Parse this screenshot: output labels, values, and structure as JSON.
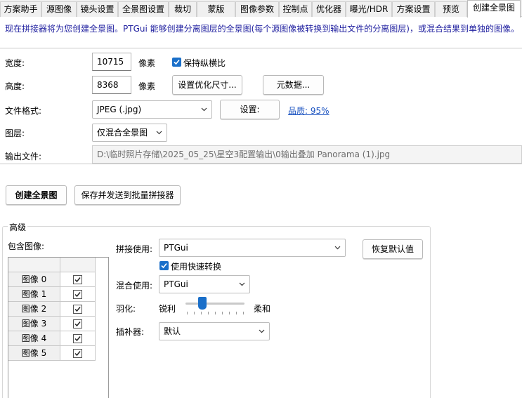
{
  "tabs": [
    {
      "label": "方案助手"
    },
    {
      "label": "源图像"
    },
    {
      "label": "镜头设置"
    },
    {
      "label": "全景图设置"
    },
    {
      "label": "裁切"
    },
    {
      "label": "蒙版"
    },
    {
      "label": "图像参数"
    },
    {
      "label": "控制点"
    },
    {
      "label": "优化器"
    },
    {
      "label": "曝光/HDR"
    },
    {
      "label": "方案设置"
    },
    {
      "label": "预览"
    },
    {
      "label": "创建全景图",
      "active": true
    }
  ],
  "info_text": "现在拼接器将为您创建全景图。PTGui 能够创建分离图层的全景图(每个源图像被转换到输出文件的分离图层)，或混合结果到单独的图像。",
  "form": {
    "width_label": "宽度:",
    "width_value": "10715",
    "width_unit": "像素",
    "keep_ratio_label": "保持纵横比",
    "keep_ratio_checked": true,
    "height_label": "高度:",
    "height_value": "8368",
    "height_unit": "像素",
    "optimize_size_button": "设置优化尺寸...",
    "metadata_button": "元数据...",
    "format_label": "文件格式:",
    "format_value": "JPEG (.jpg)",
    "format_settings_button": "设置:",
    "quality_link": "品质: 95%",
    "layers_label": "图层:",
    "layers_value": "仅混合全景图",
    "output_label": "输出文件:",
    "output_value": "D:\\临时照片存储\\2025_05_25\\星空3配置输出\\0输出叠加 Panorama (1).jpg"
  },
  "actions": {
    "create_button": "创建全景图",
    "save_batch_button": "保存并发送到批量拼接器"
  },
  "advanced": {
    "group_title": "高级",
    "include_images_label": "包含图像:",
    "images": [
      {
        "name": "图像 0",
        "checked": true
      },
      {
        "name": "图像 1",
        "checked": true
      },
      {
        "name": "图像 2",
        "checked": true
      },
      {
        "name": "图像 3",
        "checked": true
      },
      {
        "name": "图像 4",
        "checked": true
      },
      {
        "name": "图像 5",
        "checked": true
      }
    ],
    "stitcher_label": "拼接使用:",
    "stitcher_value": "PTGui",
    "restore_defaults_button": "恢复默认值",
    "fast_transform_label": "使用快速转换",
    "fast_transform_checked": true,
    "blender_label": "混合使用:",
    "blender_value": "PTGui",
    "feather_label": "羽化:",
    "feather_sharp": "锐利",
    "feather_smooth": "柔和",
    "feather_level": 0.25,
    "interpolator_label": "插补器:",
    "interpolator_value": "默认"
  },
  "colors": {
    "accent": "#1a6fc9",
    "info_text": "#1f1f9f",
    "link": "#1a52c0"
  }
}
